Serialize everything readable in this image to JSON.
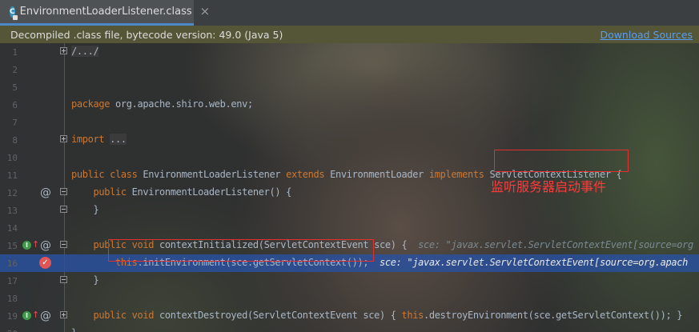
{
  "tab": {
    "title": "EnvironmentLoaderListener.class",
    "icon": "class-file-icon",
    "close": "×"
  },
  "banner": {
    "text": "Decompiled .class file, bytecode version: 49.0 (Java 5)",
    "link": "Download Sources"
  },
  "annotation": {
    "label": "监听服务器启动事件"
  },
  "lines": [
    {
      "num": "1",
      "t1": "/.../"
    },
    {
      "num": "2"
    },
    {
      "num": "5"
    },
    {
      "num": "6",
      "k1": "package",
      "t1": " org.apache.shiro.web.env;"
    },
    {
      "num": "7"
    },
    {
      "num": "8",
      "k1": "import",
      "t1": " ",
      "f1": "..."
    },
    {
      "num": "10"
    },
    {
      "num": "11",
      "k1": "public class",
      "t1": " EnvironmentLoaderListener ",
      "k2": "extends",
      "t2": " EnvironmentLoader ",
      "k3": "implements",
      "t3": " ServletContextListener {"
    },
    {
      "num": "12",
      "t0": "    ",
      "k1": "public",
      "t1": " EnvironmentLoaderListener() {"
    },
    {
      "num": "13",
      "t1": "    }"
    },
    {
      "num": "14"
    },
    {
      "num": "15",
      "t0": "    ",
      "k1": "public void",
      "t1": " contextInitialized(ServletContextEvent sce) {",
      "h1": "  sce: \"javax.servlet.ServletContextEvent[source=org"
    },
    {
      "num": "16",
      "t0": "        ",
      "k1": "this",
      "t1": ".initEnvironment(sce.getServletContext());",
      "h1": "  sce: \"javax.servlet.ServletContextEvent[source=org.apach"
    },
    {
      "num": "17",
      "t1": "    }"
    },
    {
      "num": "18"
    },
    {
      "num": "19",
      "t0": "    ",
      "k1": "public void",
      "t1": " contextDestroyed(ServletContextEvent sce) { ",
      "k2": "this",
      "t2": ".destroyEnvironment(sce.getServletContext()); }"
    },
    {
      "num": "20",
      "t1": "}"
    }
  ]
}
